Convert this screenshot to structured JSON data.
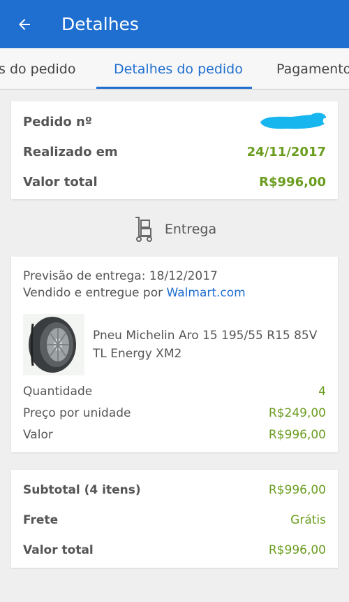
{
  "header": {
    "title": "Detalhes",
    "back_icon": "arrow-left-icon"
  },
  "tabs": [
    {
      "label": "s do pedido",
      "active": false
    },
    {
      "label": "Detalhes do pedido",
      "active": true
    },
    {
      "label": "Pagamento",
      "active": false
    }
  ],
  "order_summary": {
    "order_number_label": "Pedido nº",
    "placed_label": "Realizado em",
    "placed_date": "24/11/2017",
    "total_label": "Valor total",
    "total_value": "R$996,00"
  },
  "delivery_section": {
    "label": "Entrega",
    "icon": "delivery-cart-icon"
  },
  "shipment": {
    "forecast": "Previsão de entrega: 18/12/2017",
    "sold_by_prefix": "Vendido e entregue por ",
    "sold_by_link": "Walmart.com",
    "product": {
      "name": "Pneu Michelin Aro 15 195/55 R15 85V TL Energy XM2",
      "image_icon": "tire-icon"
    },
    "quantity_label": "Quantidade",
    "quantity_value": "4",
    "unit_price_label": "Preço por unidade",
    "unit_price_value": "R$249,00",
    "value_label": "Valor",
    "value_value": "R$996,00"
  },
  "totals": {
    "subtotal_label": "Subtotal (4 itens)",
    "subtotal_value": "R$996,00",
    "shipping_label": "Frete",
    "shipping_value": "Grátis",
    "total_label": "Valor total",
    "total_value": "R$996,00"
  },
  "colors": {
    "primary": "#1f6fd1",
    "price_green": "#6a9d1f",
    "redaction": "#18b6ee"
  }
}
